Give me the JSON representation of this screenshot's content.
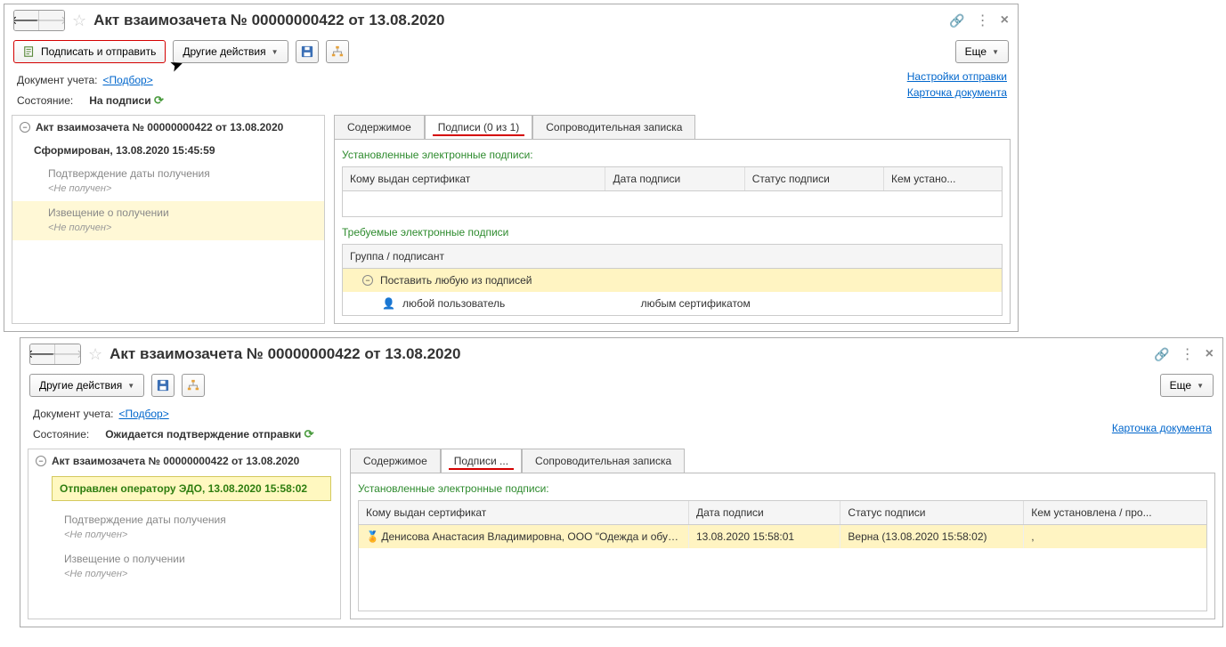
{
  "win1": {
    "title": "Акт взаимозачета № 00000000422 от 13.08.2020",
    "toolbar": {
      "sign_send": "Подписать и отправить",
      "other_actions": "Другие действия",
      "more": "Еще"
    },
    "meta": {
      "doc_label": "Документ учета:",
      "selection_link": "<Подбор>",
      "state_label": "Состояние:",
      "state_value": "На подписи"
    },
    "top_links": {
      "send_settings": "Настройки отправки",
      "doc_card": "Карточка документа"
    },
    "tree": {
      "root": "Акт взаимозачета № 00000000422 от 13.08.2020",
      "formed": "Сформирован, 13.08.2020 15:45:59",
      "confirm_recv": "Подтверждение даты получения",
      "not_received": "<Не получен>",
      "notice_recv": "Извещение о получении"
    },
    "tabs": {
      "content": "Содержимое",
      "sigs": "Подписи (0 из 1)",
      "note": "Сопроводительная записка"
    },
    "panel": {
      "installed_title": "Установленные электронные подписи:",
      "required_title": "Требуемые электронные подписи",
      "cols": {
        "cert_to": "Кому выдан сертификат",
        "sig_date": "Дата подписи",
        "sig_status": "Статус подписи",
        "set_by": "Кем устано...",
        "group": "Группа / подписант"
      },
      "any_sig": "Поставить любую из подписей",
      "any_user": "любой пользователь",
      "any_cert": "любым сертификатом"
    }
  },
  "win2": {
    "title": "Акт взаимозачета № 00000000422 от 13.08.2020",
    "toolbar": {
      "other_actions": "Другие действия",
      "more": "Еще"
    },
    "meta": {
      "doc_label": "Документ учета:",
      "selection_link": "<Подбор>",
      "state_label": "Состояние:",
      "state_value": "Ожидается подтверждение отправки"
    },
    "top_links": {
      "doc_card": "Карточка документа"
    },
    "tree": {
      "root": "Акт взаимозачета № 00000000422 от 13.08.2020",
      "sent": "Отправлен оператору ЭДО, 13.08.2020 15:58:02",
      "confirm_recv": "Подтверждение даты получения",
      "not_received": "<Не получен>",
      "notice_recv": "Извещение о получении"
    },
    "tabs": {
      "content": "Содержимое",
      "sigs": "Подписи ...",
      "note": "Сопроводительная записка"
    },
    "panel": {
      "installed_title": "Установленные электронные подписи:",
      "cols": {
        "cert_to": "Кому выдан сертификат",
        "sig_date": "Дата подписи",
        "sig_status": "Статус подписи",
        "set_by": "Кем установлена / про..."
      },
      "row": {
        "cert_to": "Денисова Анастасия Владимировна, ООО \"Одежда и обувь\"...",
        "sig_date": "13.08.2020 15:58:01",
        "sig_status": "Верна (13.08.2020 15:58:02)",
        "set_by": ","
      }
    }
  }
}
